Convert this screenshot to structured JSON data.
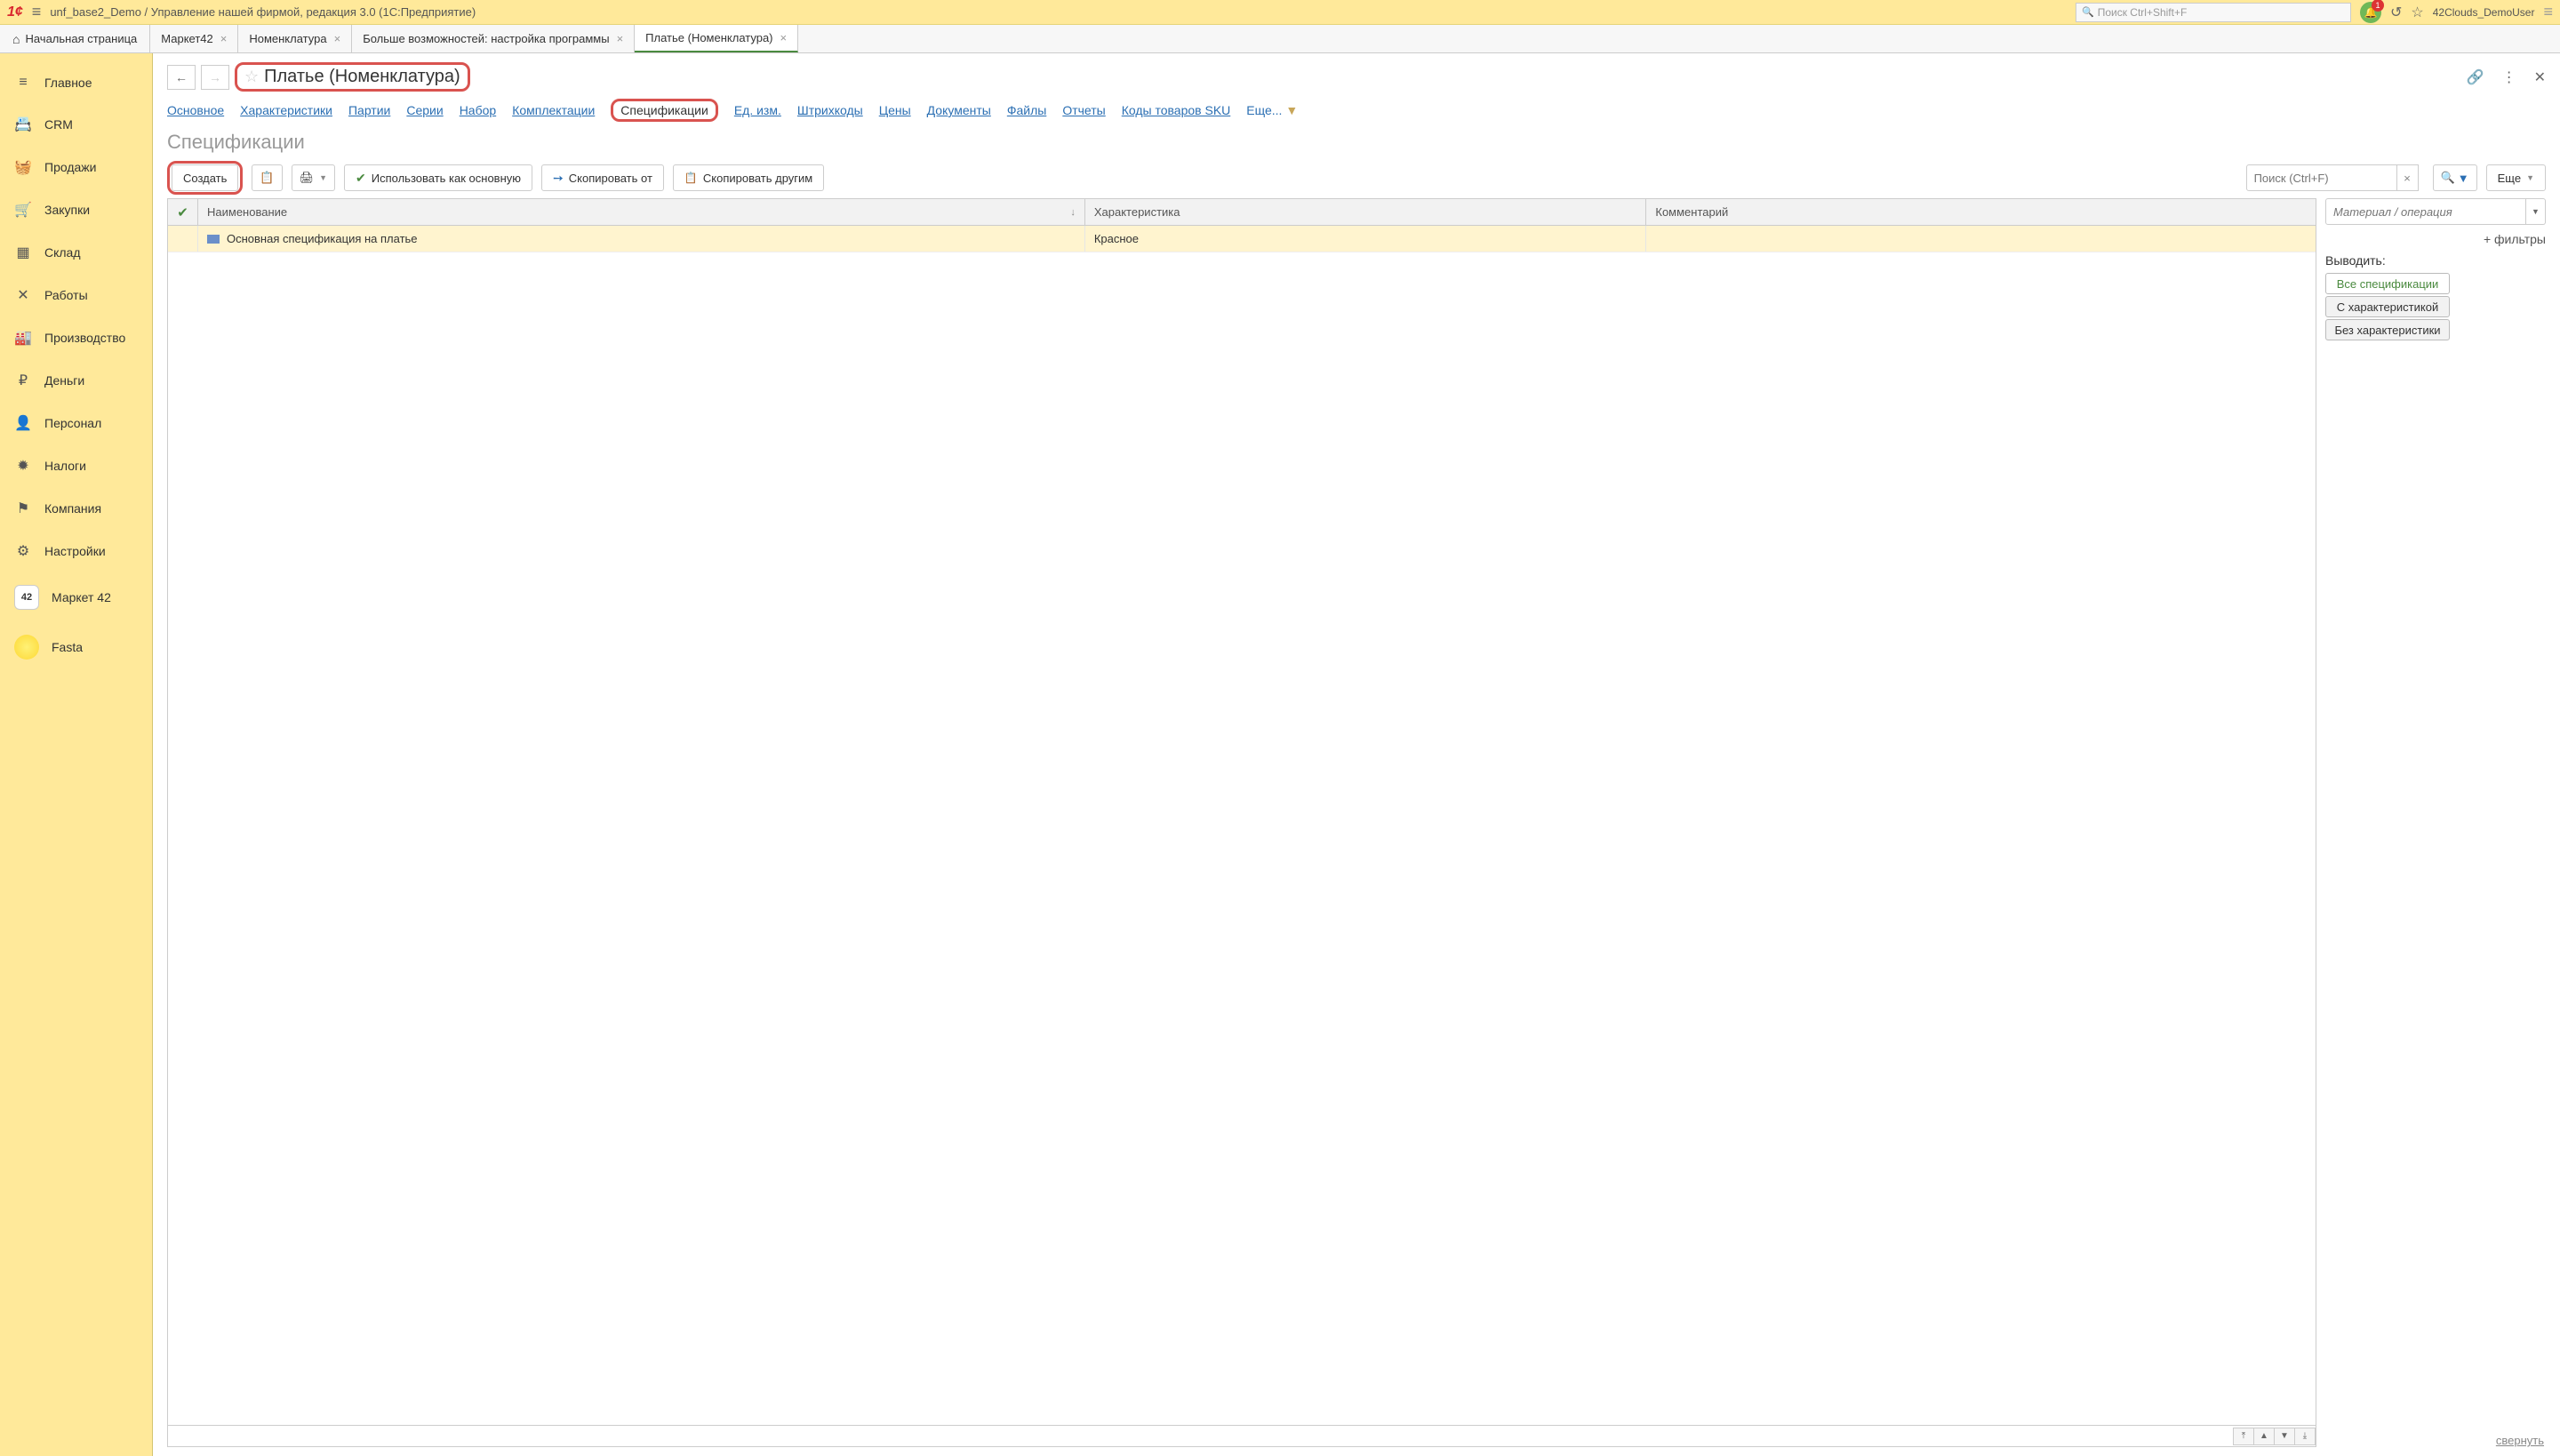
{
  "topbar": {
    "app_title": "unf_base2_Demo / Управление нашей фирмой, редакция 3.0  (1С:Предприятие)",
    "search_placeholder": "Поиск Ctrl+Shift+F",
    "notif_count": "1",
    "username": "42Clouds_DemoUser"
  },
  "tabs": {
    "home": "Начальная страница",
    "items": [
      {
        "label": "Маркет42",
        "active": false
      },
      {
        "label": "Номенклатура",
        "active": false
      },
      {
        "label": "Больше возможностей: настройка программы",
        "active": false
      },
      {
        "label": "Платье (Номенклатура)",
        "active": true
      }
    ]
  },
  "sidebar": [
    {
      "icon": "≡",
      "label": "Главное"
    },
    {
      "icon": "📇",
      "label": "CRM"
    },
    {
      "icon": "🛍",
      "label": "Продажи"
    },
    {
      "icon": "🛒",
      "label": "Закупки"
    },
    {
      "icon": "📦",
      "label": "Склад"
    },
    {
      "icon": "🛠",
      "label": "Работы"
    },
    {
      "icon": "🏭",
      "label": "Производство"
    },
    {
      "icon": "₽",
      "label": "Деньги"
    },
    {
      "icon": "👥",
      "label": "Персонал"
    },
    {
      "icon": "🦅",
      "label": "Налоги"
    },
    {
      "icon": "🏴",
      "label": "Компания"
    },
    {
      "icon": "⚙",
      "label": "Настройки"
    },
    {
      "icon": "42",
      "label": "Маркет 42",
      "special": "42"
    },
    {
      "icon": "",
      "label": "Fasta",
      "special": "fasta"
    }
  ],
  "page": {
    "title": "Платье (Номенклатура)",
    "section_title": "Спецификации"
  },
  "subnav": [
    "Основное",
    "Характеристики",
    "Партии",
    "Серии",
    "Набор",
    "Комплектации",
    "Спецификации",
    "Ед. изм.",
    "Штрихкоды",
    "Цены",
    "Документы",
    "Файлы",
    "Отчеты",
    "Коды товаров SKU"
  ],
  "subnav_more": "Еще...",
  "toolbar": {
    "create": "Создать",
    "use_as_main": "Использовать как основную",
    "copy_from": "Скопировать от",
    "copy_to": "Скопировать другим",
    "search_placeholder": "Поиск (Ctrl+F)",
    "more": "Еще"
  },
  "table": {
    "cols": {
      "name": "Наименование",
      "char": "Характеристика",
      "comm": "Комментарий"
    },
    "rows": [
      {
        "name": "Основная спецификация на платье",
        "char": "Красное",
        "comm": ""
      }
    ]
  },
  "right_panel": {
    "material_placeholder": "Материал / операция",
    "filters": "+ фильтры",
    "output_label": "Выводить:",
    "buttons": [
      "Все спецификации",
      "С характеристикой",
      "Без характеристики"
    ]
  },
  "collapse": "свернуть"
}
